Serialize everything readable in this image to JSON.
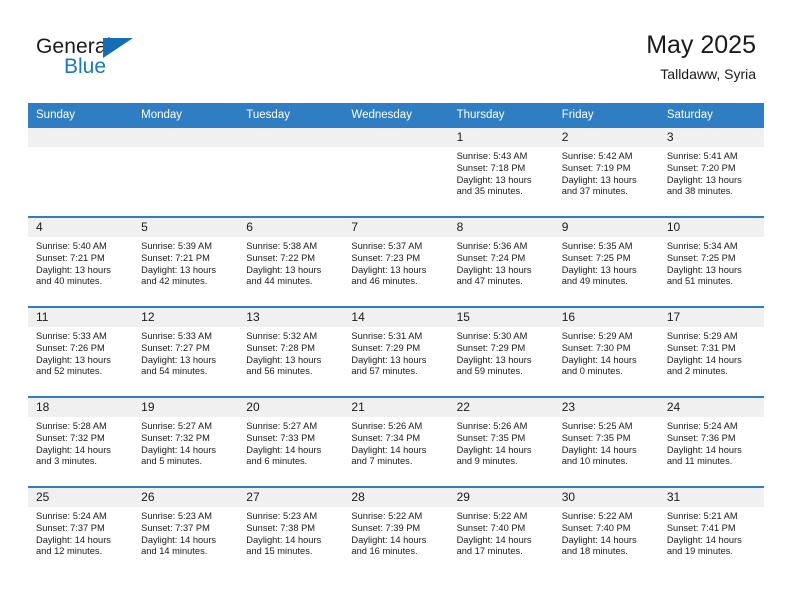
{
  "brand": {
    "name_top": "General",
    "name_bottom": "Blue",
    "accent_color": "#1878c4",
    "triangle_color": "#156eb5"
  },
  "header": {
    "title": "May 2025",
    "subtitle": "Talldaww, Syria"
  },
  "theme": {
    "header_row_bg": "#2f7ec4",
    "day_band_bg": "#f0f0f0",
    "row_divider": "#2f7ec4"
  },
  "weekdays": [
    "Sunday",
    "Monday",
    "Tuesday",
    "Wednesday",
    "Thursday",
    "Friday",
    "Saturday"
  ],
  "weeks": [
    [
      {
        "day": "",
        "sunrise": "",
        "sunset": "",
        "daylight1": "",
        "daylight2": ""
      },
      {
        "day": "",
        "sunrise": "",
        "sunset": "",
        "daylight1": "",
        "daylight2": ""
      },
      {
        "day": "",
        "sunrise": "",
        "sunset": "",
        "daylight1": "",
        "daylight2": ""
      },
      {
        "day": "",
        "sunrise": "",
        "sunset": "",
        "daylight1": "",
        "daylight2": ""
      },
      {
        "day": "1",
        "sunrise": "Sunrise: 5:43 AM",
        "sunset": "Sunset: 7:18 PM",
        "daylight1": "Daylight: 13 hours",
        "daylight2": "and 35 minutes."
      },
      {
        "day": "2",
        "sunrise": "Sunrise: 5:42 AM",
        "sunset": "Sunset: 7:19 PM",
        "daylight1": "Daylight: 13 hours",
        "daylight2": "and 37 minutes."
      },
      {
        "day": "3",
        "sunrise": "Sunrise: 5:41 AM",
        "sunset": "Sunset: 7:20 PM",
        "daylight1": "Daylight: 13 hours",
        "daylight2": "and 38 minutes."
      }
    ],
    [
      {
        "day": "4",
        "sunrise": "Sunrise: 5:40 AM",
        "sunset": "Sunset: 7:21 PM",
        "daylight1": "Daylight: 13 hours",
        "daylight2": "and 40 minutes."
      },
      {
        "day": "5",
        "sunrise": "Sunrise: 5:39 AM",
        "sunset": "Sunset: 7:21 PM",
        "daylight1": "Daylight: 13 hours",
        "daylight2": "and 42 minutes."
      },
      {
        "day": "6",
        "sunrise": "Sunrise: 5:38 AM",
        "sunset": "Sunset: 7:22 PM",
        "daylight1": "Daylight: 13 hours",
        "daylight2": "and 44 minutes."
      },
      {
        "day": "7",
        "sunrise": "Sunrise: 5:37 AM",
        "sunset": "Sunset: 7:23 PM",
        "daylight1": "Daylight: 13 hours",
        "daylight2": "and 46 minutes."
      },
      {
        "day": "8",
        "sunrise": "Sunrise: 5:36 AM",
        "sunset": "Sunset: 7:24 PM",
        "daylight1": "Daylight: 13 hours",
        "daylight2": "and 47 minutes."
      },
      {
        "day": "9",
        "sunrise": "Sunrise: 5:35 AM",
        "sunset": "Sunset: 7:25 PM",
        "daylight1": "Daylight: 13 hours",
        "daylight2": "and 49 minutes."
      },
      {
        "day": "10",
        "sunrise": "Sunrise: 5:34 AM",
        "sunset": "Sunset: 7:25 PM",
        "daylight1": "Daylight: 13 hours",
        "daylight2": "and 51 minutes."
      }
    ],
    [
      {
        "day": "11",
        "sunrise": "Sunrise: 5:33 AM",
        "sunset": "Sunset: 7:26 PM",
        "daylight1": "Daylight: 13 hours",
        "daylight2": "and 52 minutes."
      },
      {
        "day": "12",
        "sunrise": "Sunrise: 5:33 AM",
        "sunset": "Sunset: 7:27 PM",
        "daylight1": "Daylight: 13 hours",
        "daylight2": "and 54 minutes."
      },
      {
        "day": "13",
        "sunrise": "Sunrise: 5:32 AM",
        "sunset": "Sunset: 7:28 PM",
        "daylight1": "Daylight: 13 hours",
        "daylight2": "and 56 minutes."
      },
      {
        "day": "14",
        "sunrise": "Sunrise: 5:31 AM",
        "sunset": "Sunset: 7:29 PM",
        "daylight1": "Daylight: 13 hours",
        "daylight2": "and 57 minutes."
      },
      {
        "day": "15",
        "sunrise": "Sunrise: 5:30 AM",
        "sunset": "Sunset: 7:29 PM",
        "daylight1": "Daylight: 13 hours",
        "daylight2": "and 59 minutes."
      },
      {
        "day": "16",
        "sunrise": "Sunrise: 5:29 AM",
        "sunset": "Sunset: 7:30 PM",
        "daylight1": "Daylight: 14 hours",
        "daylight2": "and 0 minutes."
      },
      {
        "day": "17",
        "sunrise": "Sunrise: 5:29 AM",
        "sunset": "Sunset: 7:31 PM",
        "daylight1": "Daylight: 14 hours",
        "daylight2": "and 2 minutes."
      }
    ],
    [
      {
        "day": "18",
        "sunrise": "Sunrise: 5:28 AM",
        "sunset": "Sunset: 7:32 PM",
        "daylight1": "Daylight: 14 hours",
        "daylight2": "and 3 minutes."
      },
      {
        "day": "19",
        "sunrise": "Sunrise: 5:27 AM",
        "sunset": "Sunset: 7:32 PM",
        "daylight1": "Daylight: 14 hours",
        "daylight2": "and 5 minutes."
      },
      {
        "day": "20",
        "sunrise": "Sunrise: 5:27 AM",
        "sunset": "Sunset: 7:33 PM",
        "daylight1": "Daylight: 14 hours",
        "daylight2": "and 6 minutes."
      },
      {
        "day": "21",
        "sunrise": "Sunrise: 5:26 AM",
        "sunset": "Sunset: 7:34 PM",
        "daylight1": "Daylight: 14 hours",
        "daylight2": "and 7 minutes."
      },
      {
        "day": "22",
        "sunrise": "Sunrise: 5:26 AM",
        "sunset": "Sunset: 7:35 PM",
        "daylight1": "Daylight: 14 hours",
        "daylight2": "and 9 minutes."
      },
      {
        "day": "23",
        "sunrise": "Sunrise: 5:25 AM",
        "sunset": "Sunset: 7:35 PM",
        "daylight1": "Daylight: 14 hours",
        "daylight2": "and 10 minutes."
      },
      {
        "day": "24",
        "sunrise": "Sunrise: 5:24 AM",
        "sunset": "Sunset: 7:36 PM",
        "daylight1": "Daylight: 14 hours",
        "daylight2": "and 11 minutes."
      }
    ],
    [
      {
        "day": "25",
        "sunrise": "Sunrise: 5:24 AM",
        "sunset": "Sunset: 7:37 PM",
        "daylight1": "Daylight: 14 hours",
        "daylight2": "and 12 minutes."
      },
      {
        "day": "26",
        "sunrise": "Sunrise: 5:23 AM",
        "sunset": "Sunset: 7:37 PM",
        "daylight1": "Daylight: 14 hours",
        "daylight2": "and 14 minutes."
      },
      {
        "day": "27",
        "sunrise": "Sunrise: 5:23 AM",
        "sunset": "Sunset: 7:38 PM",
        "daylight1": "Daylight: 14 hours",
        "daylight2": "and 15 minutes."
      },
      {
        "day": "28",
        "sunrise": "Sunrise: 5:22 AM",
        "sunset": "Sunset: 7:39 PM",
        "daylight1": "Daylight: 14 hours",
        "daylight2": "and 16 minutes."
      },
      {
        "day": "29",
        "sunrise": "Sunrise: 5:22 AM",
        "sunset": "Sunset: 7:40 PM",
        "daylight1": "Daylight: 14 hours",
        "daylight2": "and 17 minutes."
      },
      {
        "day": "30",
        "sunrise": "Sunrise: 5:22 AM",
        "sunset": "Sunset: 7:40 PM",
        "daylight1": "Daylight: 14 hours",
        "daylight2": "and 18 minutes."
      },
      {
        "day": "31",
        "sunrise": "Sunrise: 5:21 AM",
        "sunset": "Sunset: 7:41 PM",
        "daylight1": "Daylight: 14 hours",
        "daylight2": "and 19 minutes."
      }
    ]
  ]
}
